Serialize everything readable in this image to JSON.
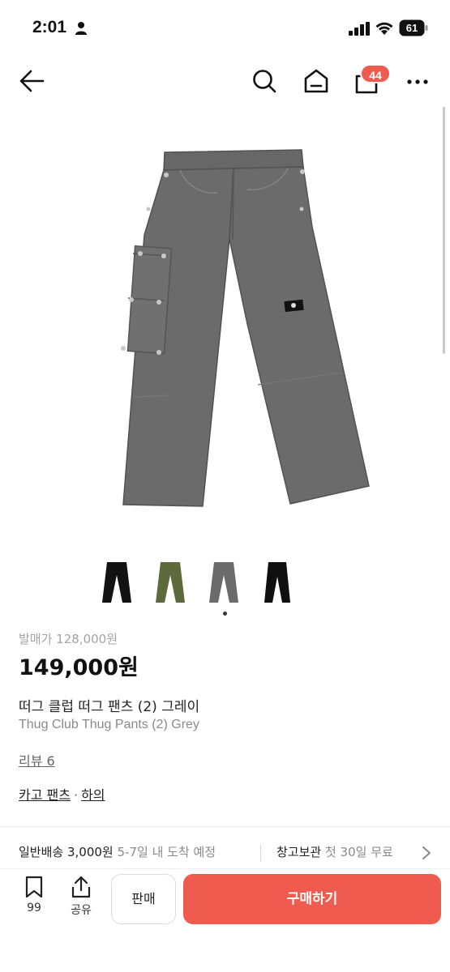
{
  "status_bar": {
    "time": "2:01",
    "battery": "61",
    "icons": [
      "person-icon",
      "cellular-signal-icon",
      "wifi-icon",
      "battery-icon"
    ]
  },
  "nav": {
    "icons": [
      "back-arrow-icon",
      "search-icon",
      "home-icon",
      "shopping-bag-icon",
      "more-icon"
    ],
    "cart_count": "44"
  },
  "product": {
    "image_icon": "grey-cargo-pants-image",
    "thumbnails": [
      {
        "icon": "black-pants-thumbnail"
      },
      {
        "icon": "olive-pants-thumbnail"
      },
      {
        "icon": "grey-pants-thumbnail"
      },
      {
        "icon": "black-pants-thumbnail-2"
      }
    ],
    "original_price": "발매가 128,000원",
    "price": "149,000원",
    "title_ko": "떠그 클럽 떠그 팬츠 (2) 그레이",
    "title_en": "Thug Club Thug Pants (2) Grey",
    "review_link": "리뷰 6",
    "category_1": "카고 팬츠",
    "category_sep": "·",
    "category_2": "하의"
  },
  "shipping": {
    "label": "일반배송 3,000원",
    "eta": "5-7일 내 도착 예정",
    "storage_label": "창고보관",
    "storage_sub": "첫 30일 무료"
  },
  "bottom_bar": {
    "like_count": "99",
    "share_label": "공유",
    "sell_label": "판매",
    "buy_label": "구매하기"
  },
  "colors": {
    "accent": "#ef5c4f",
    "pants_grey": "#6b6b6b",
    "olive": "#5d6a3b"
  }
}
